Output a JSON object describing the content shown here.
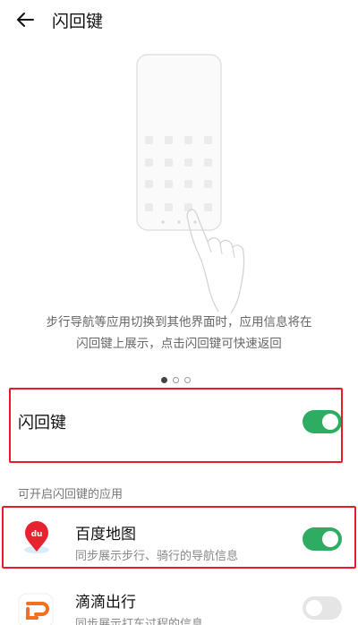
{
  "header": {
    "title": "闪回键",
    "back_icon": "arrow-left-icon"
  },
  "illustration": {
    "icon": "phone-swipe-gesture-illustration"
  },
  "description": {
    "line1": "步行导航等应用切换到其他界面时，应用信息将在",
    "line2": "闪回键上展示，点击闪回键可快速返回"
  },
  "pager": {
    "count": 3,
    "active_index": 0
  },
  "main_toggle": {
    "label": "闪回键",
    "enabled": true
  },
  "section": {
    "title": "可开启闪回键的应用"
  },
  "apps": [
    {
      "name": "百度地图",
      "desc": "同步展示步行、骑行的导航信息",
      "enabled": true,
      "icon": "baidu-maps-icon"
    },
    {
      "name": "滴滴出行",
      "desc": "同步展示打车过程的信息",
      "enabled": false,
      "icon": "didi-icon"
    }
  ],
  "colors": {
    "toggle_on": "#2dac62",
    "toggle_off": "#e5e5e5",
    "highlight": "#e81a2a",
    "baidu_red": "#e6232f",
    "didi_orange": "#f37021"
  }
}
